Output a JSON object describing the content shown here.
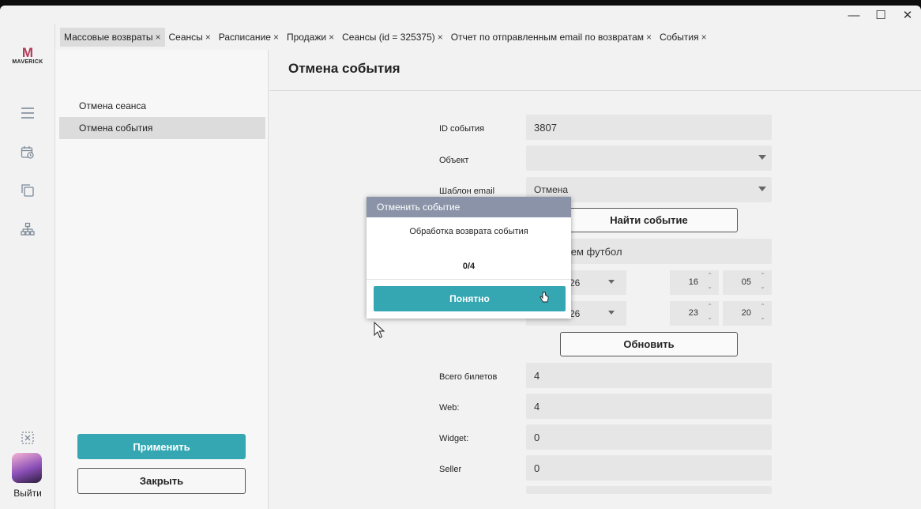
{
  "window": {
    "controls": {
      "minimize": "—",
      "maximize": "☐",
      "close": "✕"
    }
  },
  "rail": {
    "logo_mark": "M",
    "logo_text": "MAVERICK",
    "exit_label": "Выйти",
    "icons": [
      "menu-icon",
      "calendar-clock-icon",
      "copy-icon",
      "hierarchy-icon",
      "close-square-icon"
    ]
  },
  "tabs": [
    {
      "label": "Массовые возвраты",
      "close": "×"
    },
    {
      "label": "Сеансы",
      "close": "×"
    },
    {
      "label": "Расписание",
      "close": "×"
    },
    {
      "label": "Продажи",
      "close": "×"
    },
    {
      "label": "Сеансы (id = 325375)",
      "close": "×"
    },
    {
      "label": "Отчет по отправленным email по возвратам",
      "close": "×"
    },
    {
      "label": "События",
      "close": "×"
    }
  ],
  "sidenav": {
    "items": [
      {
        "label": "Отмена сеанса"
      },
      {
        "label": "Отмена события"
      }
    ],
    "apply_label": "Применить",
    "close_label": "Закрыть"
  },
  "main": {
    "title": "Отмена события",
    "event_id_label": "ID события",
    "event_id_value": "3807",
    "object_label": "Объект",
    "object_value": "",
    "email_template_label": "Шаблон email",
    "email_template_value": "Отмена",
    "find_event_label": "Найти событие",
    "event_name_value": "чем футбол",
    "date_from_value": "26",
    "time_from_hour": "16",
    "time_from_min": "05",
    "date_to_value": "26",
    "time_to_hour": "23",
    "time_to_min": "20",
    "refresh_label": "Обновить",
    "total_tickets_label": "Всего билетов",
    "total_tickets_value": "4",
    "web_label": "Web:",
    "web_value": "4",
    "widget_label": "Widget:",
    "widget_value": "0",
    "seller_label": "Seller",
    "seller_value": "0"
  },
  "modal": {
    "title": "Отменить событие",
    "message": "Обработка возврата события",
    "progress": "0/4",
    "ok_label": "Понятно"
  },
  "colors": {
    "accent": "#35a7b3",
    "modal_header": "#8a93a8",
    "field_bg": "#e6e6e6",
    "selected_bg": "#dcdcdc"
  }
}
